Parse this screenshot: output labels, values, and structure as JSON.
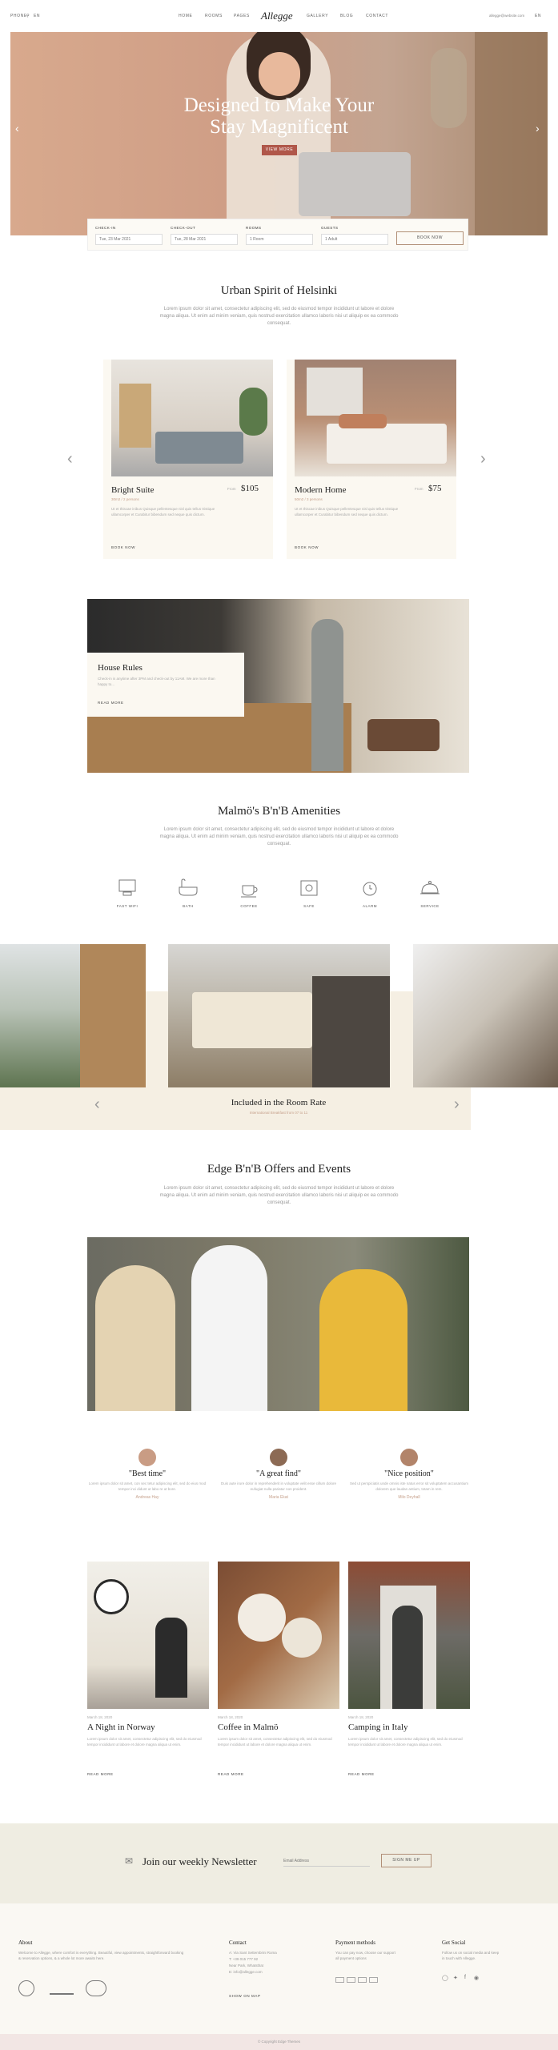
{
  "header": {
    "left_phone": "Phone",
    "left_lang": "EN",
    "nav_left": [
      "Home",
      "Rooms",
      "Pages"
    ],
    "logo": "Allegge",
    "nav_right": [
      "Gallery",
      "Blog",
      "Contact"
    ],
    "right_email": "allegge@website.com",
    "right_lang": "EN"
  },
  "hero": {
    "title_line1": "Designed to Make Your",
    "title_line2": "Stay Magnificent",
    "button": "View More"
  },
  "booking": {
    "checkin_label": "Check-in",
    "checkin_value": "Tue, 23 Mar 2021",
    "checkout_label": "Check-out",
    "checkout_value": "Tue, 28 Mar 2021",
    "rooms_label": "Rooms",
    "rooms_value": "1 Room",
    "guests_label": "Guests",
    "guests_value": "1 Adult",
    "button": "Book now"
  },
  "urban": {
    "title": "Urban Spirit of Helsinki",
    "text": "Lorem ipsum dolor sit amet, consectetur adipiscing elit, sed do eiusmod tempor incididunt ut labore et dolore magna aliqua. Ut enim ad minim veniam, quis nostrud exercitation ullamco laboris nisi ut aliquip ex ea commodo consequat."
  },
  "rooms": [
    {
      "name": "Bright Suite",
      "from": "From",
      "price": "$105",
      "meta": "30m2 / 2 persons",
      "text": "Ut et thiscae inibus Quisque pellentesque nisl quis tellus tristique ullamcorper et Curabitur bibendum sed neque quis dictum.",
      "link": "Book now"
    },
    {
      "name": "Modern Home",
      "from": "From",
      "price": "$75",
      "meta": "50m2 / 3 persons",
      "text": "Ut et thiscae inibus Quisque pellentesque nisl quis tellus tristique ullamcorper et Curabitur bibendum sed neque quis dictum.",
      "link": "Book now"
    }
  ],
  "rules": {
    "title": "House Rules",
    "text": "Check-in is anytime after 3PM and check-out by 11AM. We are more than happy to...",
    "link": "Read more"
  },
  "amenities": {
    "title": "Malmö's B'n'B Amenities",
    "text": "Lorem ipsum dolor sit amet, consectetur adipiscing elit, sed do eiusmod tempor incididunt ut labore et dolore magna aliqua. Ut enim ad minim veniam, quis nostrud exercitation ullamco laboris nisi ut aliquip ex ea commodo consequat.",
    "items": [
      {
        "label": "Fast Wifi",
        "icon": "computer-icon"
      },
      {
        "label": "Bath",
        "icon": "bathtub-icon"
      },
      {
        "label": "Coffee",
        "icon": "coffee-cup-icon"
      },
      {
        "label": "Safe",
        "icon": "safe-icon"
      },
      {
        "label": "Alarm",
        "icon": "alarm-clock-icon"
      },
      {
        "label": "Service",
        "icon": "cloche-icon"
      }
    ]
  },
  "gallery": {
    "caption_title": "Included in the Room Rate",
    "caption_sub": "International Breakfast from 07 to 11"
  },
  "offers": {
    "title": "Edge B'n'B Offers and Events",
    "text": "Lorem ipsum dolor sit amet, consectetur adipiscing elit, sed do eiusmod tempor incididunt ut labore et dolore magna aliqua. Ut enim ad minim veniam, quis nostrud exercitation ullamco laboris nisi ut aliquip ex ea commodo consequat."
  },
  "testimonials": [
    {
      "title": "\"Best time\"",
      "text": "Lorem ipsum dolor sit amet, con sec tetur adipiscing elit, sed do eius mod tempor inci didunt ut labo re ut bore.",
      "name": "Andreas Hay"
    },
    {
      "title": "\"A great find\"",
      "text": "Duis aute irure dolor in reprehenderit in voluptate velit esse cillum dolore eufugiat nulla pariatur non proident.",
      "name": "Maria Ekat"
    },
    {
      "title": "\"Nice position\"",
      "text": "Sed ut perspiciatis unde omnis iste natus error sit voluptatem accusantium dolorem que laudan antium, totam in rem.",
      "name": "Milo Deyhall"
    }
  ],
  "posts": [
    {
      "date": "March 18, 2020",
      "title": "A Night in Norway",
      "text": "Lorem ipsum dolor sit amet, consectetur adipiscing elit, sed do eiusmod tempor incididunt ut labore et dolore magna aliqua ut enim.",
      "link": "Read more"
    },
    {
      "date": "March 18, 2020",
      "title": "Coffee in Malmö",
      "text": "Lorem ipsum dolor sit amet, consectetur adipiscing elit, sed do eiusmod tempor incididunt ut labore et dolore magna aliqua ut enim.",
      "link": "Read more"
    },
    {
      "date": "March 18, 2020",
      "title": "Camping in Italy",
      "text": "Lorem ipsum dolor sit amet, consectetur adipiscing elit, sed do eiusmod tempor incididunt ut labore et dolore magna aliqua ut enim.",
      "link": "Read more"
    }
  ],
  "newsletter": {
    "title": "Join our weekly Newsletter",
    "placeholder": "Email Address",
    "button": "Sign me up"
  },
  "footer": {
    "about_title": "About",
    "about_text": "Welcome to Allegge, where comfort is everything. Beautiful, view appointments, straightforward booking & reservation options, & a whole lot more awaits here.",
    "contact_title": "Contact",
    "contact_lines": [
      "A: Via Sant Settembrini Roma",
      "T: +39 015 777 92",
      "Near Park, Whatsthat",
      "E: info@allegge.com"
    ],
    "contact_link": "Show on map",
    "payment_title": "Payment methods",
    "payment_text": "You can pay now, choose our support all payment options",
    "social_title": "Get Social",
    "social_text": "Follow us on social media and keep in touch with Allegge.",
    "copyright": "© Copyright Edge Themes"
  }
}
